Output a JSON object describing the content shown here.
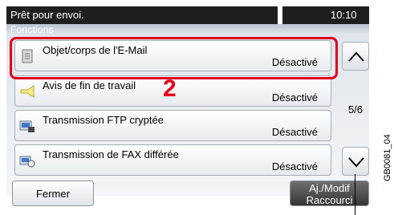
{
  "status_bar": {
    "message": "Prêt pour envoi.",
    "time": "10:10"
  },
  "header": {
    "title": "Fonctions"
  },
  "items": [
    {
      "label": "Objet/corps de l'E-Mail",
      "status": "Désactivé",
      "icon": "document-icon"
    },
    {
      "label": "Avis de fin de travail",
      "status": "Désactivé",
      "icon": "notification-icon"
    },
    {
      "label": "Transmission FTP cryptée",
      "status": "Désactivé",
      "icon": "ftp-encrypted-icon"
    },
    {
      "label": "Transmission de FAX différée",
      "status": "Désactivé",
      "icon": "delayed-fax-icon"
    }
  ],
  "pagination": {
    "indicator": "5/6"
  },
  "footer": {
    "close_label": "Fermer",
    "shortcut_line1": "Aj./Modif",
    "shortcut_line2": "Raccourci"
  },
  "annotation": {
    "step_number": "2",
    "figure_code": "GB0081_04"
  },
  "colors": {
    "highlight": "#e2001a",
    "status_bar": "#1f1f1f"
  }
}
